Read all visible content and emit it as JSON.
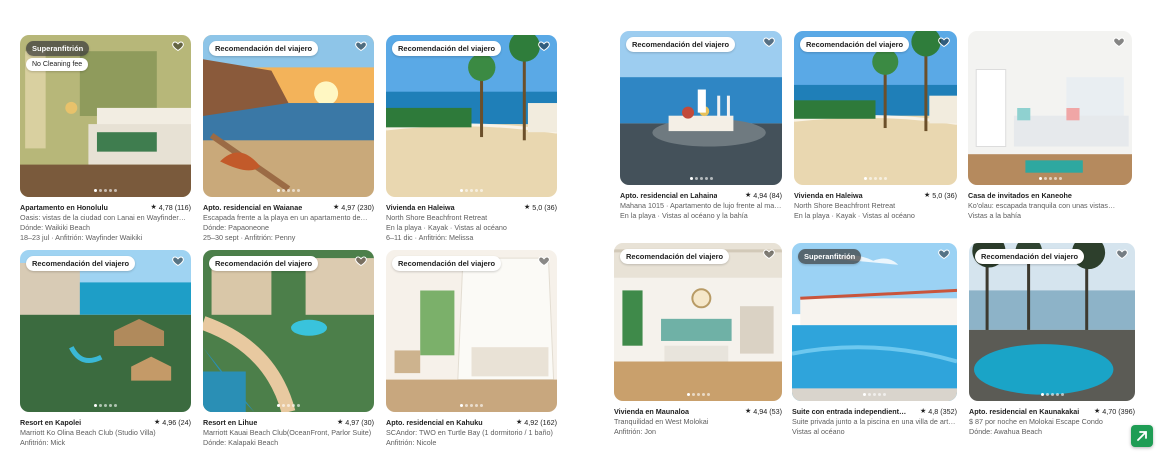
{
  "listings": [
    {
      "badge": "Superanfitrión",
      "badge_dark": true,
      "tag": "No Cleaning fee",
      "title": "Apartamento en Honolulu",
      "rating": "4,78 (116)",
      "lines": [
        "Oasis: vistas de la ciudad con Lanai en Wayfinder…",
        "Dónde: Waikiki Beach",
        "18–23 jul · Anfitrión: Wayfinder Waikiki"
      ]
    },
    {
      "badge": "Recomendación del viajero",
      "title": "Apto. residencial en Waianae",
      "rating": "4,97 (230)",
      "lines": [
        "Escapada frente a la playa en un apartamento de…",
        "Dónde: Papaoneone",
        "25–30 sept · Anfitrión: Penny"
      ]
    },
    {
      "badge": "Recomendación del viajero",
      "title": "Vivienda en Haleiwa",
      "rating": "5,0 (36)",
      "lines": [
        "North Shore Beachfront Retreat",
        "En la playa · Kayak · Vistas al océano",
        "6–11 dic · Anfitrión: Melissa"
      ]
    },
    {
      "badge": "Recomendación del viajero",
      "title": "Apto. residencial en Lahaina",
      "rating": "4,94 (84)",
      "lines": [
        "Mahana 1015 · Apartamento de lujo frente al mar…",
        "En la playa · Vistas al océano y la bahía"
      ]
    },
    {
      "badge": "Recomendación del viajero",
      "title": "Vivienda en Haleiwa",
      "rating": "5,0 (36)",
      "lines": [
        "North Shore Beachfront Retreat",
        "En la playa · Kayak · Vistas al océano"
      ]
    },
    {
      "badge": "",
      "title": "Casa de invitados en Kaneohe",
      "rating": "",
      "lines": [
        "Ko'olau: escapada tranquila con unas vistas…",
        "Vistas a la bahía"
      ]
    },
    {
      "badge": "Recomendación del viajero",
      "title": "Resort en Kapolei",
      "rating": "4,96 (24)",
      "lines": [
        "Marriott Ko Olina Beach Club (Studio Villa)",
        "Anfitrión: Mick"
      ]
    },
    {
      "badge": "Recomendación del viajero",
      "title": "Resort en Lihue",
      "rating": "4,97 (30)",
      "lines": [
        "Marriott Kauai Beach Club(OceanFront, Parlor Suite)",
        "Dónde: Kalapaki Beach"
      ]
    },
    {
      "badge": "Recomendación del viajero",
      "title": "Apto. residencial en Kahuku",
      "rating": "4,92 (162)",
      "lines": [
        "SCAndor: TWO en Turtle Bay (1 dormitorio / 1 baño)",
        "Anfitrión: Nicole"
      ]
    },
    {
      "badge": "Recomendación del viajero",
      "title": "Vivienda en Maunaloa",
      "rating": "4,94 (53)",
      "lines": [
        "Tranquilidad en West Molokai",
        "Anfitrión: Jon"
      ]
    },
    {
      "badge": "Superanfitrión",
      "badge_dark": true,
      "title": "Suite con entrada independiente en…",
      "rating": "4,8 (352)",
      "lines": [
        "Suite privada junto a la piscina en una villa de artista…",
        "Vistas al océano"
      ]
    },
    {
      "badge": "Recomendación del viajero",
      "title": "Apto. residencial en Kaunakakai",
      "rating": "4,70 (396)",
      "lines": [
        "$ 87 por noche en Molokai Escape Condo",
        "Dónde: Awahua Beach"
      ]
    }
  ]
}
